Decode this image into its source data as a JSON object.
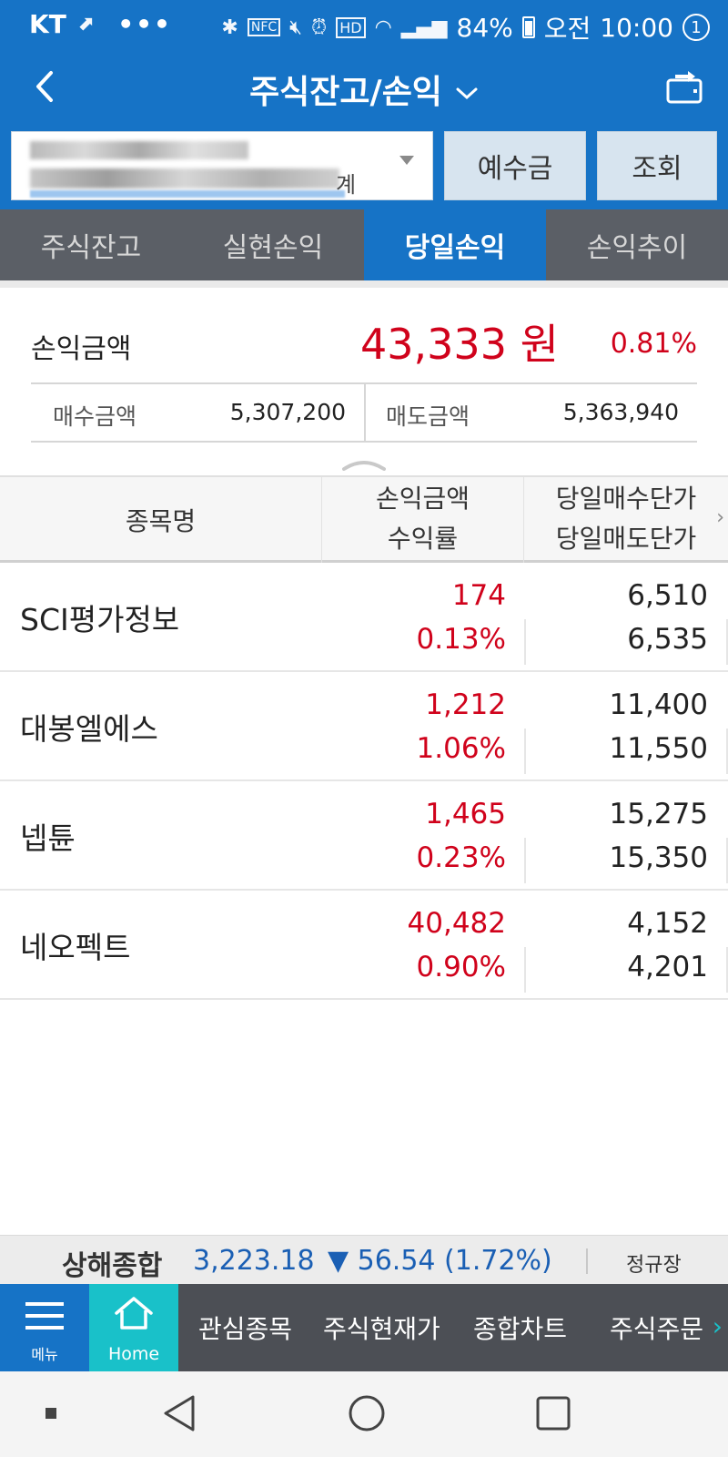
{
  "status_bar": {
    "carrier": "KT",
    "battery": "84%",
    "ampm": "오전",
    "time": "10:00",
    "hd_label": "HD",
    "nfc_label": "NFC",
    "notification_count": "1"
  },
  "header": {
    "title": "주식잔고/손익"
  },
  "account": {
    "suffix": "계"
  },
  "buttons": {
    "deposit": "예수금",
    "query": "조회"
  },
  "tabs": [
    {
      "label": "주식잔고",
      "active": false
    },
    {
      "label": "실현손익",
      "active": false
    },
    {
      "label": "당일손익",
      "active": true
    },
    {
      "label": "손익추이",
      "active": false
    }
  ],
  "summary": {
    "pl_label": "손익금액",
    "pl_amount": "43,333 원",
    "pl_rate": "0.81%",
    "buy_label": "매수금액",
    "buy_amount": "5,307,200",
    "sell_label": "매도금액",
    "sell_amount": "5,363,940"
  },
  "table": {
    "headers": {
      "name": "종목명",
      "pl_line1": "손익금액",
      "pl_line2": "수익률",
      "price_line1": "당일매수단가",
      "price_line2": "당일매도단가"
    },
    "rows": [
      {
        "name": "SCI평가정보",
        "pl": "174",
        "rate": "0.13%",
        "buy_price": "6,510",
        "sell_price": "6,535"
      },
      {
        "name": "대봉엘에스",
        "pl": "1,212",
        "rate": "1.06%",
        "buy_price": "11,400",
        "sell_price": "11,550"
      },
      {
        "name": "넵튠",
        "pl": "1,465",
        "rate": "0.23%",
        "buy_price": "15,275",
        "sell_price": "15,350"
      },
      {
        "name": "네오펙트",
        "pl": "40,482",
        "rate": "0.90%",
        "buy_price": "4,152",
        "sell_price": "4,201"
      }
    ]
  },
  "ticker": {
    "index_name": "상해종합",
    "value": "3,223.18",
    "change": "▼ 56.54 (1.72%)",
    "session": "정규장"
  },
  "bottom_nav": {
    "menu": "메뉴",
    "home": "Home",
    "items": [
      "관심종목",
      "주식현재가",
      "종합차트",
      "주식주문"
    ]
  },
  "colors": {
    "primary_blue": "#1673c6",
    "profit_red": "#d0021b",
    "home_teal": "#19c1c9",
    "tab_gray": "#5b5f66",
    "index_blue": "#1a5fb4"
  }
}
